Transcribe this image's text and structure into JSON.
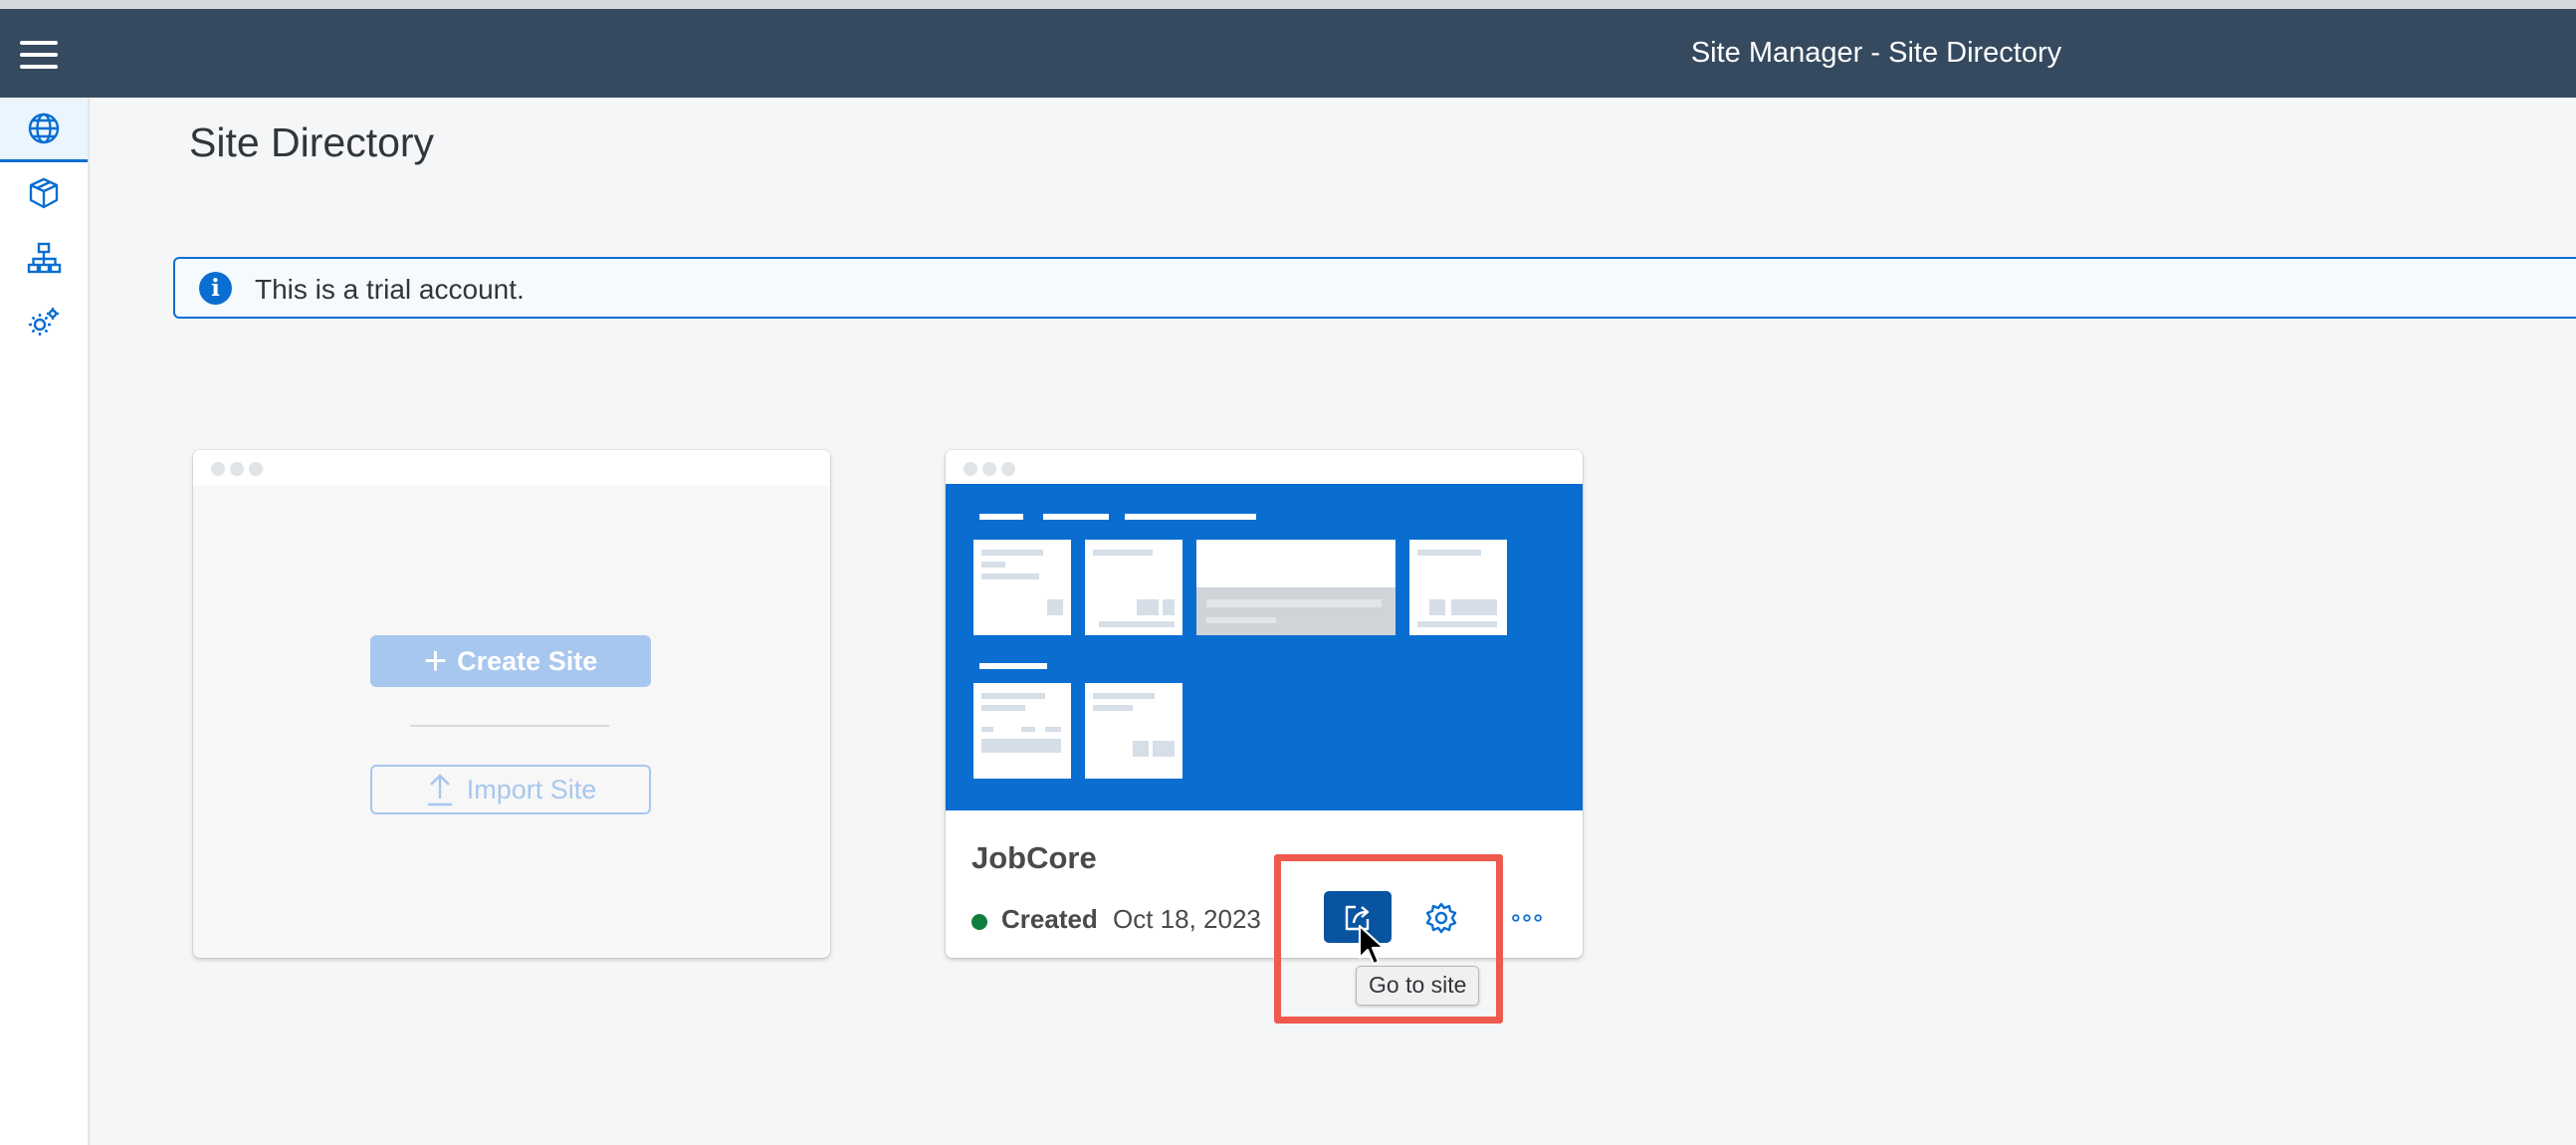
{
  "shell": {
    "title": "Site Manager - Site Directory",
    "bg_color": "#354a5f"
  },
  "side_nav": {
    "items": [
      {
        "name": "globe-icon",
        "selected": true
      },
      {
        "name": "content-package-icon",
        "selected": false
      },
      {
        "name": "hierarchy-icon",
        "selected": false
      },
      {
        "name": "settings-gears-icon",
        "selected": false
      }
    ]
  },
  "page": {
    "title": "Site Directory"
  },
  "info_strip": {
    "icon": "information-icon",
    "text": "This is a trial account.",
    "accent": "#0a6ed1"
  },
  "create_card": {
    "create_label": "Create Site",
    "import_label": "Import Site"
  },
  "site_card": {
    "name": "JobCore",
    "status": "Created",
    "status_color": "#107e3e",
    "date": "Oct 18, 2023",
    "actions": {
      "goto_icon": "share-arrow-icon",
      "settings_icon": "gear-icon",
      "more_icon": "overflow-dots-icon"
    }
  },
  "tooltip": {
    "text": "Go to site"
  },
  "annotation": {
    "highlight_color": "#ee5a4e"
  }
}
